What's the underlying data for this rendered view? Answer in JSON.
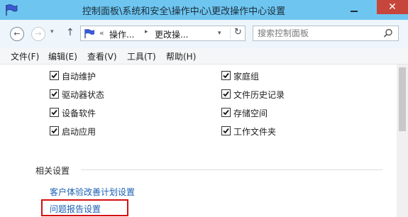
{
  "window": {
    "title": "控制面板\\系统和安全\\操作中心\\更改操作中心设置",
    "close_glyph": "✕"
  },
  "nav": {
    "back_glyph": "←",
    "forward_glyph": "→",
    "up_glyph": "↑",
    "breadcrumb_sep": "«",
    "breadcrumb_1": "操作...",
    "breadcrumb_arrow": "▸",
    "breadcrumb_2": "更改操...",
    "dropdown_glyph": "▾",
    "refresh_glyph": "↻",
    "search_placeholder": "搜索控制面板"
  },
  "menu": [
    "文件(F)",
    "编辑(E)",
    "查看(V)",
    "工具(T)",
    "帮助(H)"
  ],
  "checkboxes_left": [
    {
      "label": "自动维护",
      "checked": true
    },
    {
      "label": "驱动器状态",
      "checked": true
    },
    {
      "label": "设备软件",
      "checked": true
    },
    {
      "label": "启动应用",
      "checked": true
    }
  ],
  "checkboxes_right": [
    {
      "label": "家庭组",
      "checked": true
    },
    {
      "label": "文件历史记录",
      "checked": true
    },
    {
      "label": "存储空间",
      "checked": true
    },
    {
      "label": "工作文件夹",
      "checked": true
    }
  ],
  "related": {
    "title": "相关设置",
    "links": [
      "客户体验改善计划设置",
      "问题报告设置"
    ]
  },
  "colors": {
    "titlebar": "#6ec6f0",
    "link": "#1a5fb4",
    "highlight": "#d40f0f"
  }
}
